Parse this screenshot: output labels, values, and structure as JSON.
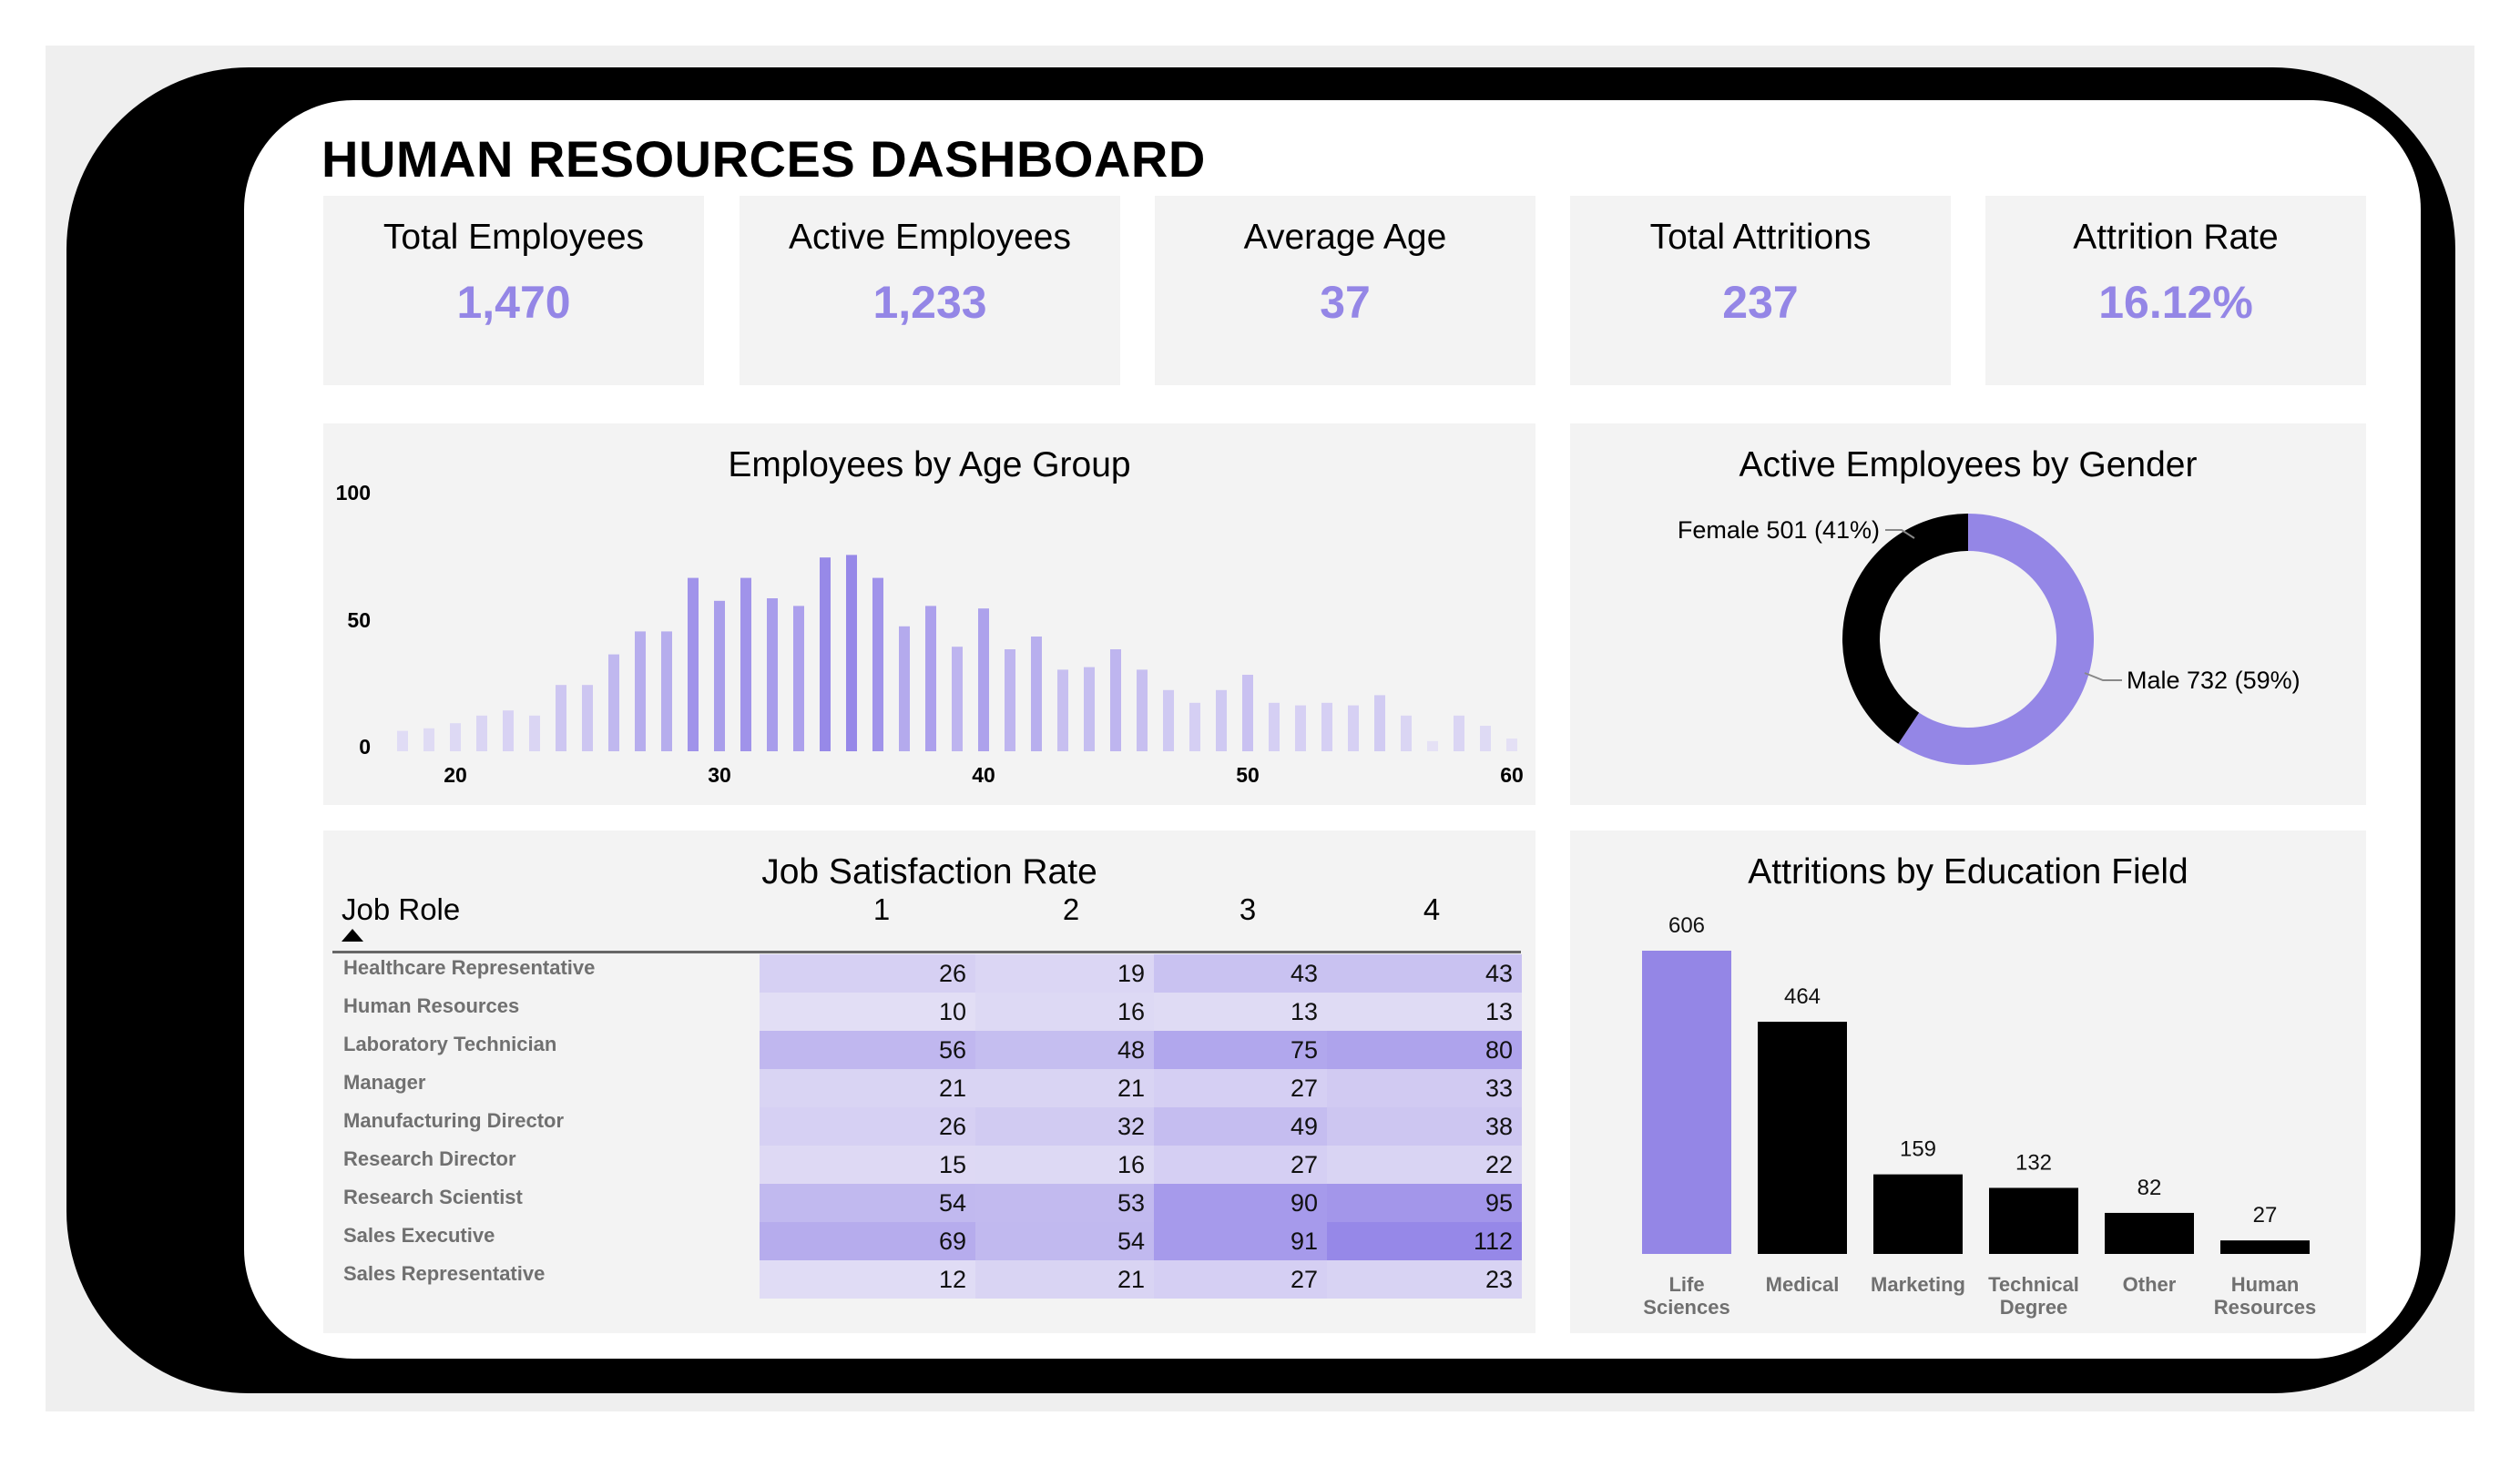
{
  "dashboard": {
    "title": "HUMAN RESOURCES DASHBOARD"
  },
  "kpis": [
    {
      "label": "Total Employees",
      "value": "1,470"
    },
    {
      "label": "Active Employees",
      "value": "1,233"
    },
    {
      "label": "Average Age",
      "value": "37"
    },
    {
      "label": "Total Attritions",
      "value": "237"
    },
    {
      "label": "Attrition Rate",
      "value": "16.12%"
    }
  ],
  "colors": {
    "accent": "#9486e6",
    "dark": "#000000",
    "card": "#f3f3f3"
  },
  "age_chart": {
    "title": "Employees by Age Group",
    "y_ticks": [
      "100",
      "50",
      "0"
    ],
    "x_ticks": [
      "20",
      "30",
      "40",
      "50",
      "60"
    ]
  },
  "gender_chart": {
    "title": "Active Employees by Gender",
    "female_label": "Female 501 (41%)",
    "male_label": "Male 732 (59%)"
  },
  "job_table": {
    "title": "Job Satisfaction Rate",
    "role_header": "Job Role",
    "col_headers": [
      "1",
      "2",
      "3",
      "4"
    ],
    "rows": [
      {
        "role": "Healthcare Representative",
        "values": [
          26,
          19,
          43,
          43
        ]
      },
      {
        "role": "Human Resources",
        "values": [
          10,
          16,
          13,
          13
        ]
      },
      {
        "role": "Laboratory Technician",
        "values": [
          56,
          48,
          75,
          80
        ]
      },
      {
        "role": "Manager",
        "values": [
          21,
          21,
          27,
          33
        ]
      },
      {
        "role": "Manufacturing Director",
        "values": [
          26,
          32,
          49,
          38
        ]
      },
      {
        "role": "Research Director",
        "values": [
          15,
          16,
          27,
          22
        ]
      },
      {
        "role": "Research Scientist",
        "values": [
          54,
          53,
          90,
          95
        ]
      },
      {
        "role": "Sales Executive",
        "values": [
          69,
          54,
          91,
          112
        ]
      },
      {
        "role": "Sales Representative",
        "values": [
          12,
          21,
          27,
          23
        ]
      }
    ]
  },
  "edu_chart": {
    "title": "Attritions by Education Field"
  },
  "chart_data": [
    {
      "type": "bar",
      "title": "Employees by Age Group",
      "xlabel": "",
      "ylabel": "",
      "ylim": [
        0,
        100
      ],
      "xlim": [
        18,
        60
      ],
      "grid": false,
      "x": [
        18,
        19,
        20,
        21,
        22,
        23,
        24,
        25,
        26,
        27,
        28,
        29,
        30,
        31,
        32,
        33,
        34,
        35,
        36,
        37,
        38,
        39,
        40,
        41,
        42,
        43,
        44,
        45,
        46,
        47,
        48,
        49,
        50,
        51,
        52,
        53,
        54,
        55,
        56,
        57,
        58,
        59,
        60
      ],
      "values": [
        8,
        9,
        11,
        14,
        16,
        14,
        26,
        26,
        38,
        47,
        47,
        68,
        59,
        68,
        60,
        57,
        76,
        77,
        68,
        49,
        57,
        41,
        56,
        40,
        45,
        32,
        33,
        40,
        32,
        24,
        19,
        24,
        30,
        19,
        18,
        19,
        18,
        22,
        14,
        4,
        14,
        10,
        5
      ]
    },
    {
      "type": "pie",
      "title": "Active Employees by Gender",
      "labels": [
        "Female",
        "Male"
      ],
      "values": [
        501,
        732
      ],
      "percent": [
        41,
        59
      ],
      "colors": [
        "#000000",
        "#9486e6"
      ]
    },
    {
      "type": "heatmap",
      "title": "Job Satisfaction Rate",
      "rows": [
        "Healthcare Representative",
        "Human Resources",
        "Laboratory Technician",
        "Manager",
        "Manufacturing Director",
        "Research Director",
        "Research Scientist",
        "Sales Executive",
        "Sales Representative"
      ],
      "columns": [
        "1",
        "2",
        "3",
        "4"
      ],
      "values": [
        [
          26,
          19,
          43,
          43
        ],
        [
          10,
          16,
          13,
          13
        ],
        [
          56,
          48,
          75,
          80
        ],
        [
          21,
          21,
          27,
          33
        ],
        [
          26,
          32,
          49,
          38
        ],
        [
          15,
          16,
          27,
          22
        ],
        [
          54,
          53,
          90,
          95
        ],
        [
          69,
          54,
          91,
          112
        ],
        [
          12,
          21,
          27,
          23
        ]
      ]
    },
    {
      "type": "bar",
      "title": "Attritions by Education Field",
      "categories": [
        "Life Sciences",
        "Medical",
        "Marketing",
        "Technical Degree",
        "Other",
        "Human Resources"
      ],
      "category_lines": [
        [
          "Life",
          "Sciences"
        ],
        [
          "Medical"
        ],
        [
          "Marketing"
        ],
        [
          "Technical",
          "Degree"
        ],
        [
          "Other"
        ],
        [
          "Human",
          "Resources"
        ]
      ],
      "values": [
        606,
        464,
        159,
        132,
        82,
        27
      ],
      "colors": [
        "#9486e6",
        "#000000",
        "#000000",
        "#000000",
        "#000000",
        "#000000"
      ]
    }
  ]
}
